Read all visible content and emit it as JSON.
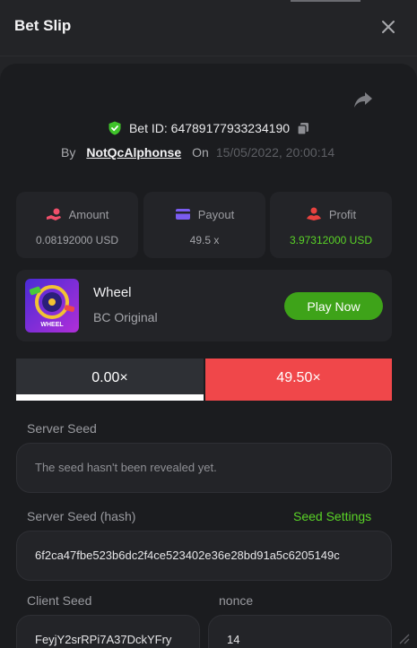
{
  "header": {
    "title": "Bet Slip"
  },
  "bet": {
    "id_label": "Bet ID:",
    "id": "64789177933234190",
    "by_label": "By",
    "user": "NotQcAlphonse",
    "on_label": "On",
    "datetime": "15/05/2022, 20:00:14"
  },
  "stats": {
    "amount": {
      "label": "Amount",
      "value": "0.08192000 USD"
    },
    "payout": {
      "label": "Payout",
      "value": "49.5 x"
    },
    "profit": {
      "label": "Profit",
      "value": "3.97312000 USD"
    }
  },
  "game": {
    "name": "Wheel",
    "provider": "BC Original",
    "play_label": "Play Now",
    "thumb_text": "WHEEL"
  },
  "multipliers": {
    "left": "0.00×",
    "right": "49.50×"
  },
  "seeds": {
    "server_seed_label": "Server Seed",
    "server_seed_value": "The seed hasn't been revealed yet.",
    "server_hash_label": "Server Seed (hash)",
    "seed_settings_label": "Seed Settings",
    "server_hash_value": "6f2ca47fbe523b6dc2f4ce523402e36e28bd91a5c6205149c",
    "client_seed_label": "Client Seed",
    "client_seed_value": "FeyjY2srRPi7A37DckYFry",
    "nonce_label": "nonce",
    "nonce_value": "14"
  },
  "colors": {
    "accent_green": "#5ad327",
    "play_button": "#3ea319",
    "loss_red": "#f0474a",
    "amount_icon": "#ef4f6a",
    "payout_icon": "#7a5cf0",
    "profit_icon": "#e8423f"
  },
  "icons": [
    "close-icon",
    "share-icon",
    "shield-check-icon",
    "copy-icon",
    "amount-icon",
    "payout-icon",
    "profit-icon"
  ]
}
